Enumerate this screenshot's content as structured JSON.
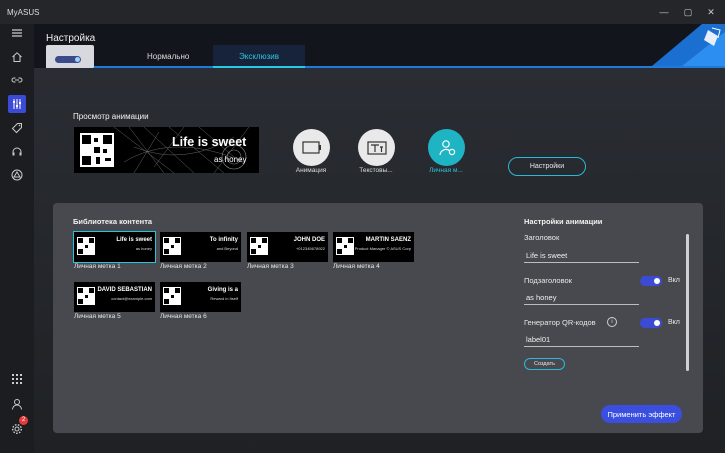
{
  "window": {
    "app_title": "MyASUS",
    "minimize": "—",
    "maximize": "▢",
    "close": "✕"
  },
  "sidebar": {
    "notification_count": "2"
  },
  "header": {
    "title": "Настройка",
    "tabs": [
      {
        "label": "Нормально"
      },
      {
        "label": "Эксклюзив"
      }
    ],
    "active_tab": "Эксклюзив"
  },
  "preview": {
    "title": "Просмотр анимации",
    "main_text": "Life is sweet",
    "sub_text": "as honey"
  },
  "animation_modes": [
    {
      "label": "Анимация",
      "icon": "monitor-icon"
    },
    {
      "label": "Текстовы...",
      "icon": "text-icon"
    },
    {
      "label": "Личная м...",
      "icon": "user-tag-icon"
    }
  ],
  "settings_button": "Настройки",
  "library": {
    "title": "Библиотека контента",
    "items": [
      {
        "label": "Личная метка 1",
        "main": "Life is sweet",
        "sub": "as honey"
      },
      {
        "label": "Личная метка 2",
        "main": "To infinity",
        "sub": "and Beyond"
      },
      {
        "label": "Личная метка 3",
        "main": "JOHN DOE",
        "sub": "+012345678922"
      },
      {
        "label": "Личная метка 4",
        "main": "MARTIN SAENZ",
        "sub": "Product Manager © ASUS Corp"
      },
      {
        "label": "Личная метка 5",
        "main": "DAVID SEBASTIAN",
        "sub": "contact@example.com"
      },
      {
        "label": "Личная метка 6",
        "main": "Giving is a",
        "sub": "Reward in Itself"
      }
    ]
  },
  "animation_settings": {
    "title": "Настройки анимации",
    "heading_label": "Заголовок",
    "heading_value": "Life is sweet",
    "subheading_label": "Подзаголовок",
    "subheading_value": "as honey",
    "subheading_toggle": "Вкл",
    "qr_label": "Генератор QR-кодов",
    "qr_value": "label01",
    "qr_toggle": "Вкл",
    "info": "i",
    "create_button": "Создать"
  },
  "apply_button": "Применить эффект"
}
